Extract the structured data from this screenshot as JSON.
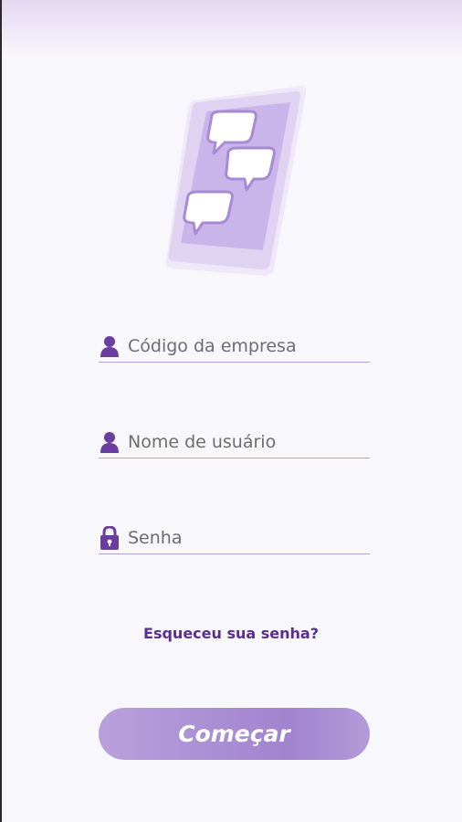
{
  "colors": {
    "accent": "#5a2d91",
    "icon": "#6a3ea1",
    "underline": "#b79fd8",
    "button": "#a88ad2",
    "background": "#f8f7fb"
  },
  "hero": {
    "icon": "phone-chat-illustration"
  },
  "form": {
    "company_code": {
      "placeholder": "Código da empresa",
      "value": "",
      "icon": "user-icon"
    },
    "username": {
      "placeholder": "Nome de usuário",
      "value": "",
      "icon": "user-icon"
    },
    "password": {
      "placeholder": "Senha",
      "value": "",
      "icon": "lock-icon"
    }
  },
  "forgot_password_label": "Esqueceu sua senha?",
  "start_button_label": "Começar"
}
